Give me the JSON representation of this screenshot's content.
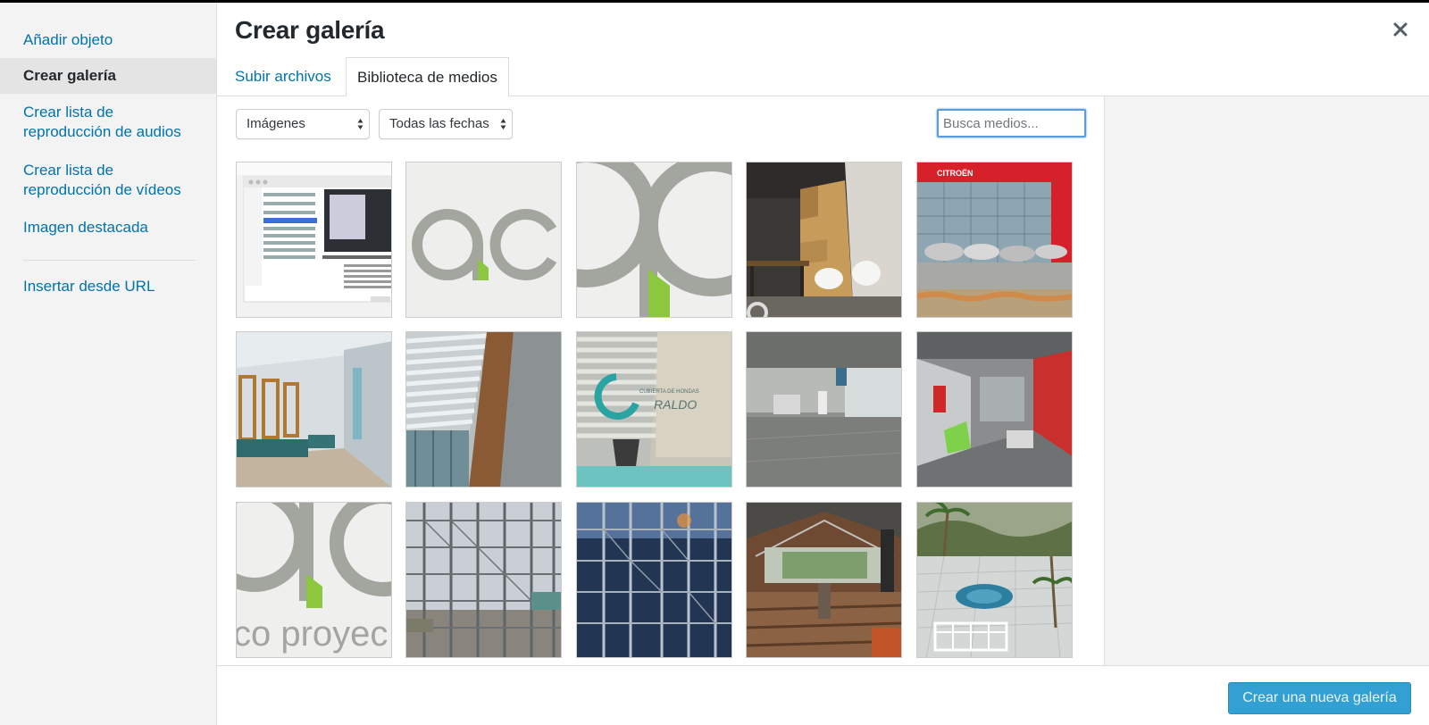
{
  "modal": {
    "title": "Crear galería",
    "close_icon": "close-icon"
  },
  "menu": {
    "items": [
      {
        "label": "Añadir objeto",
        "active": false
      },
      {
        "label": "Crear galería",
        "active": true
      },
      {
        "label_line1": "Crear lista de",
        "label_line2": "reproducción de audios",
        "active": false
      },
      {
        "label_line1": "Crear lista de",
        "label_line2": "reproducción de vídeos",
        "active": false
      },
      {
        "label": "Imagen destacada",
        "active": false
      }
    ],
    "insert_from_url": "Insertar desde URL"
  },
  "tabs": [
    {
      "label": "Subir archivos",
      "active": false
    },
    {
      "label": "Biblioteca de medios",
      "active": true
    }
  ],
  "filters": {
    "type_selected": "Imágenes",
    "date_selected": "Todas las fechas"
  },
  "search": {
    "placeholder": "Busca medios...",
    "value": ""
  },
  "attachments": [
    {
      "kind": "screenshot-finder-dialog"
    },
    {
      "kind": "logo-ac-small"
    },
    {
      "kind": "logo-ac-large"
    },
    {
      "kind": "interior-brick-wall-chairs"
    },
    {
      "kind": "citroen-dealership-render"
    },
    {
      "kind": "corridor-wood-frames-render"
    },
    {
      "kind": "louvers-window-render"
    },
    {
      "kind": "office-reception-logo-render"
    },
    {
      "kind": "showroom-gray-floor-render"
    },
    {
      "kind": "showroom-red-wall-render"
    },
    {
      "kind": "logo-ac-proyectos"
    },
    {
      "kind": "scaffolding-photo-1"
    },
    {
      "kind": "scaffolding-photo-2"
    },
    {
      "kind": "construction-site-interior-photo"
    },
    {
      "kind": "terrace-pool-photo"
    }
  ],
  "footer": {
    "create_button_label": "Crear una nueva galería"
  },
  "colors": {
    "link": "#0073aa",
    "primary_button": "#33a0d3",
    "logo_gray": "#a3a59f",
    "logo_green": "#8dc63f"
  },
  "thumb_texts": {
    "logo_text": "co proyec",
    "sign_line1": "CUBIERTA DE HONDAS",
    "sign_line2": "RALDO",
    "citroen": "CITROËN"
  }
}
